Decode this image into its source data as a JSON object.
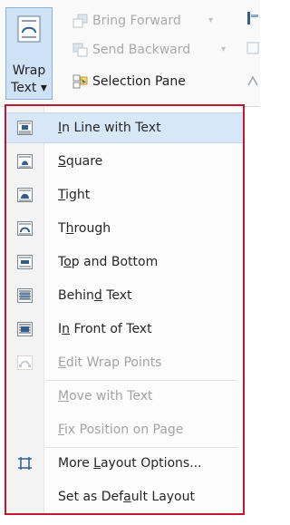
{
  "ribbon": {
    "wrap_text": {
      "line1": "Wrap",
      "line2": "Text ▾"
    },
    "bring_forward": "Bring Forward",
    "send_backward": "Send Backward",
    "selection_pane": "Selection Pane",
    "dropdown_arrow": "▾"
  },
  "menu": {
    "items": [
      {
        "icon": "in-line-with-text-icon",
        "pre": "",
        "key": "I",
        "post": "n Line with Text",
        "enabled": true
      },
      {
        "icon": "square-wrap-icon",
        "pre": "",
        "key": "S",
        "post": "quare",
        "enabled": true
      },
      {
        "icon": "tight-wrap-icon",
        "pre": "",
        "key": "T",
        "post": "ight",
        "enabled": true
      },
      {
        "icon": "through-wrap-icon",
        "pre": "T",
        "key": "h",
        "post": "rough",
        "enabled": true
      },
      {
        "icon": "top-and-bottom-icon",
        "pre": "T",
        "key": "o",
        "post": "p and Bottom",
        "enabled": true
      },
      {
        "icon": "behind-text-icon",
        "pre": "Behin",
        "key": "d",
        "post": " Text",
        "enabled": true
      },
      {
        "icon": "in-front-of-text-icon",
        "pre": "I",
        "key": "n",
        "post": " Front of Text",
        "enabled": true
      },
      {
        "icon": "edit-wrap-points-icon",
        "pre": "",
        "key": "E",
        "post": "dit Wrap Points",
        "enabled": false
      },
      {
        "icon": "",
        "pre": "",
        "key": "M",
        "post": "ove with Text",
        "enabled": false
      },
      {
        "icon": "",
        "pre": "",
        "key": "F",
        "post": "ix Position on Page",
        "enabled": false
      },
      {
        "icon": "more-layout-options-icon",
        "pre": "More ",
        "key": "L",
        "post": "ayout Options...",
        "enabled": true
      },
      {
        "icon": "",
        "pre": "Set as Def",
        "key": "a",
        "post": "ult Layout",
        "enabled": true
      }
    ]
  },
  "colors": {
    "accent": "#c0182a",
    "highlight": "#d7e7f7",
    "icon_blue": "#2f5f8f",
    "disabled": "#a3a3a3"
  }
}
